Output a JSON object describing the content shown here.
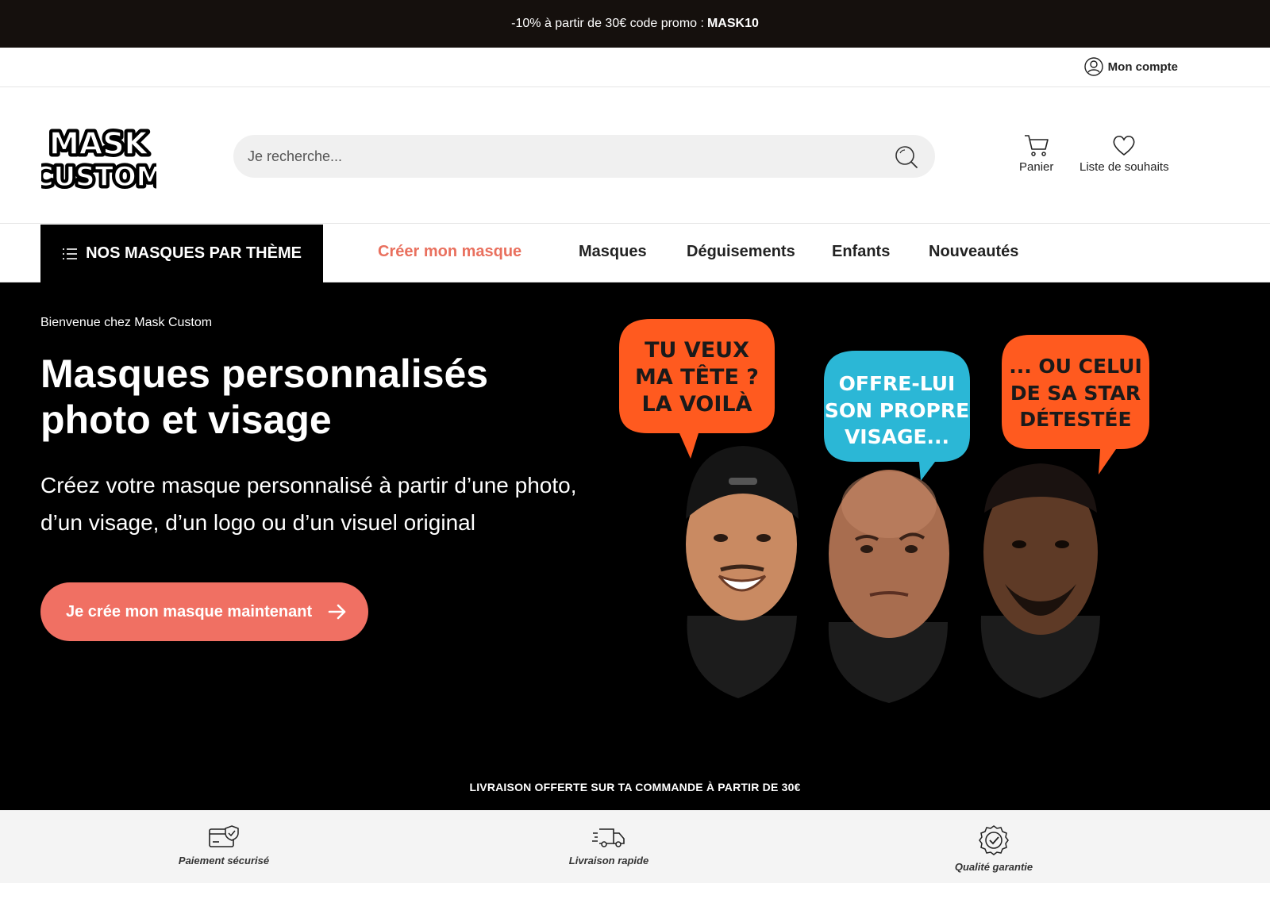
{
  "promo": {
    "text": "-10% à partir de 30€ code promo :",
    "code": "MASK10"
  },
  "account": {
    "label": "Mon compte"
  },
  "header": {
    "logo_text": [
      "MASK",
      "CUSTOM"
    ],
    "search_placeholder": "Je recherche...",
    "cart_label": "Panier",
    "wishlist_label": "Liste de souhaits"
  },
  "nav": {
    "theme_button": "NOS MASQUES PAR THÈME",
    "items": [
      "Créer mon masque",
      "Masques",
      "Déguisements",
      "Enfants",
      "Nouveautés"
    ]
  },
  "hero": {
    "welcome": "Bienvenue chez Mask Custom",
    "title_line1": "Masques personnalisés",
    "title_line2": "photo et visage",
    "subtitle": "Créez votre masque personnalisé à partir d’une photo, d’un visage, d’un logo ou d’un visuel original",
    "cta": "Je crée mon masque maintenant",
    "bubbles": [
      {
        "lines": [
          "TU VEUX",
          "MA TÊTE ?",
          "LA VOILÀ"
        ],
        "color": "#ff5a1f"
      },
      {
        "lines": [
          "OFFRE-LUI",
          "SON PROPRE",
          "VISAGE..."
        ],
        "color": "#2bb7d6"
      },
      {
        "lines": [
          "... OU CELUI",
          "DE SA STAR",
          "DÉTESTÉE"
        ],
        "color": "#ff5a1f"
      }
    ],
    "shipping": "LIVRAISON OFFERTE SUR TA COMMANDE À PARTIR DE 30€"
  },
  "features": [
    "Paiement sécurisé",
    "Livraison rapide",
    "Qualité garantie"
  ],
  "colors": {
    "accent": "#f07063",
    "nav_accent": "#e9705e",
    "promo_bg": "#15100d",
    "hero_bg": "#000000"
  }
}
